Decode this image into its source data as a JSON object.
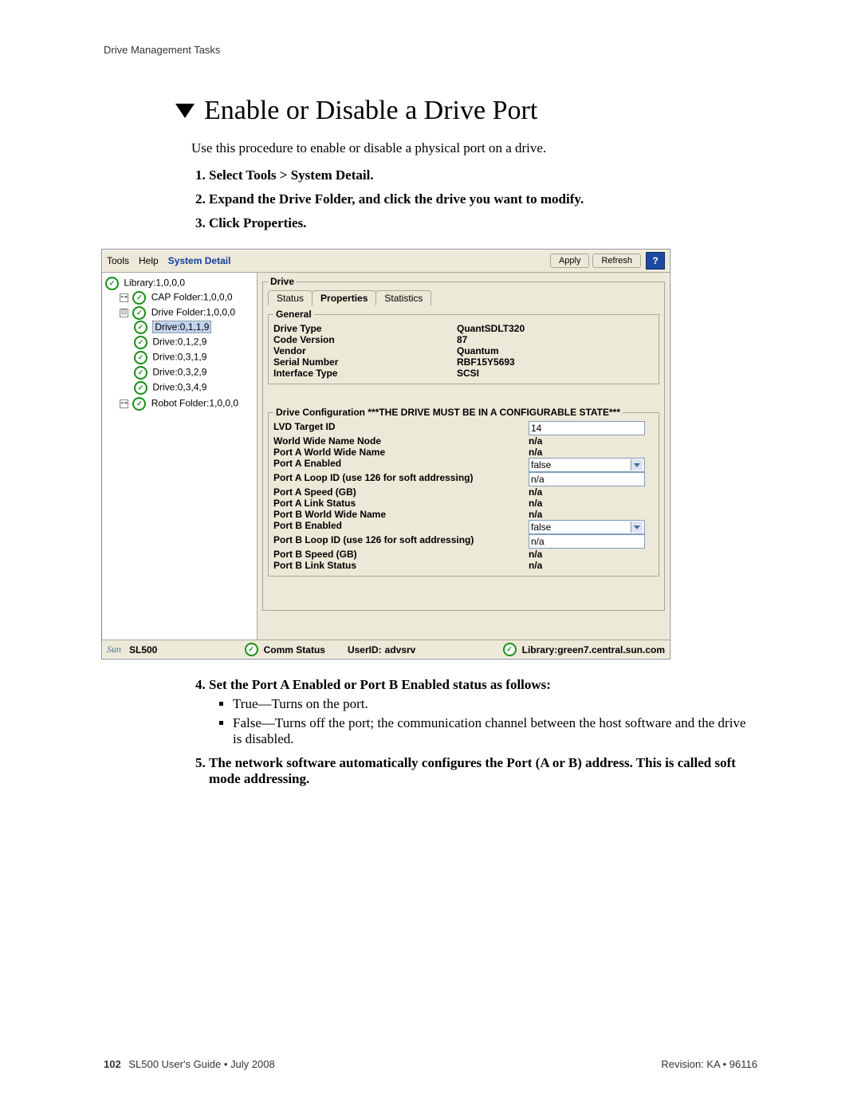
{
  "header_small": "Drive Management Tasks",
  "title": "Enable or Disable a Drive Port",
  "intro": "Use this procedure to enable or disable a physical port on a drive.",
  "steps": {
    "1": "Select Tools > System Detail.",
    "2": "Expand the Drive Folder, and click the drive you want to modify.",
    "3": "Click Properties.",
    "4": "Set the Port A Enabled or Port B Enabled status as follows:",
    "4a": "True—Turns on the port.",
    "4b": "False—Turns off the port; the communication channel between the host software and the drive is disabled.",
    "5": "The network software automatically configures the Port (A or B) address. This is called soft mode addressing."
  },
  "menubar": {
    "tools": "Tools",
    "help": "Help",
    "system_detail": "System Detail",
    "apply": "Apply",
    "refresh": "Refresh",
    "help_icon": "?"
  },
  "tree": {
    "library": "Library:1,0,0,0",
    "cap": "CAP Folder:1,0,0,0",
    "drive_folder": "Drive Folder:1,0,0,0",
    "d1": "Drive:0,1,1,9",
    "d2": "Drive:0,1,2,9",
    "d3": "Drive:0,3,1,9",
    "d4": "Drive:0,3,2,9",
    "d5": "Drive:0,3,4,9",
    "robot": "Robot Folder:1,0,0,0"
  },
  "detail": {
    "drive_legend": "Drive",
    "tabs": {
      "status": "Status",
      "properties": "Properties",
      "statistics": "Statistics"
    },
    "general_legend": "General",
    "general": {
      "drive_type_l": "Drive Type",
      "drive_type_v": "QuantSDLT320",
      "code_version_l": "Code Version",
      "code_version_v": "87",
      "vendor_l": "Vendor",
      "vendor_v": "Quantum",
      "serial_l": "Serial Number",
      "serial_v": "RBF15Y5693",
      "iface_l": "Interface Type",
      "iface_v": "SCSI"
    },
    "config_legend": "Drive Configuration    ***THE DRIVE MUST BE IN A CONFIGURABLE STATE***",
    "config": {
      "lvd_l": "LVD Target ID",
      "lvd_v": "14",
      "wwn_node_l": "World Wide Name Node",
      "wwn_node_v": "n/a",
      "a_wwn_l": "Port A World Wide Name",
      "a_wwn_v": "n/a",
      "a_en_l": "Port A Enabled",
      "a_en_v": "false",
      "a_loop_l": "Port A Loop ID (use 126 for soft addressing)",
      "a_loop_v": "n/a",
      "a_speed_l": "Port A Speed (GB)",
      "a_speed_v": "n/a",
      "a_link_l": "Port A Link Status",
      "a_link_v": "n/a",
      "b_wwn_l": "Port B World Wide Name",
      "b_wwn_v": "n/a",
      "b_en_l": "Port B Enabled",
      "b_en_v": "false",
      "b_loop_l": "Port B Loop ID (use 126 for soft addressing)",
      "b_loop_v": "n/a",
      "b_speed_l": "Port B Speed (GB)",
      "b_speed_v": "n/a",
      "b_link_l": "Port B Link Status",
      "b_link_v": "n/a"
    }
  },
  "statusbar": {
    "logo": "Sun",
    "product": "SL500",
    "comm": "Comm Status",
    "userid_label": "UserID:",
    "userid_value": "advsrv",
    "library": "Library:green7.central.sun.com"
  },
  "footer": {
    "page": "102",
    "book": "SL500 User's Guide • July 2008",
    "revision": "Revision: KA • 96116"
  }
}
